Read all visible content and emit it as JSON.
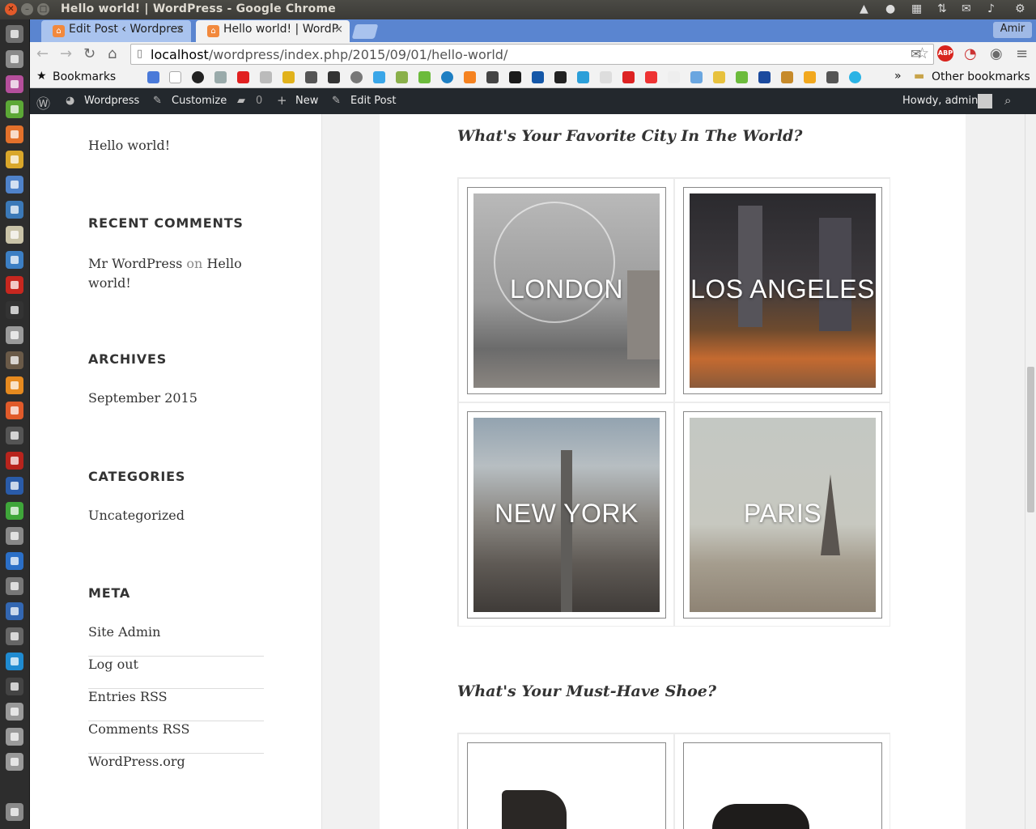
{
  "window": {
    "title": "Hello world! | WordPress - Google Chrome",
    "user": "Amir"
  },
  "tabs": [
    {
      "label": "Edit Post ‹ Wordpres",
      "close": "×"
    },
    {
      "label": "Hello world! | WordP",
      "close": "×"
    }
  ],
  "toolbar": {
    "url_host": "localhost",
    "url_path": "/wordpress/index.php/2015/09/01/hello-world/",
    "abp_label": "ABP"
  },
  "bookmarks": {
    "label": "Bookmarks",
    "overflow": "»",
    "other": "Other bookmarks"
  },
  "adminbar": {
    "site": "Wordpress",
    "customize": "Customize",
    "comments_count": "0",
    "new": "New",
    "edit": "Edit Post",
    "howdy": "Howdy, admin"
  },
  "sidebar": {
    "recent_post": "Hello world!",
    "recent_comments_title": "RECENT COMMENTS",
    "comment_author": "Mr WordPress",
    "comment_on": "on",
    "comment_post": "Hello world!",
    "archives_title": "ARCHIVES",
    "archive_item": "September 2015",
    "categories_title": "CATEGORIES",
    "category_item": "Uncategorized",
    "meta_title": "META",
    "meta_items": [
      "Site Admin",
      "Log out",
      "Entries RSS",
      "Comments RSS",
      "WordPress.org"
    ]
  },
  "content": {
    "question1": "What's Your Favorite City In The World?",
    "cities": [
      "LONDON",
      "LOS ANGELES",
      "NEW YORK",
      "PARIS"
    ],
    "question2": "What's Your Must-Have Shoe?"
  },
  "colors": {
    "admin_bar": "#23282d",
    "tab_strip": "#5a85d0",
    "accent_text": "#333333"
  }
}
